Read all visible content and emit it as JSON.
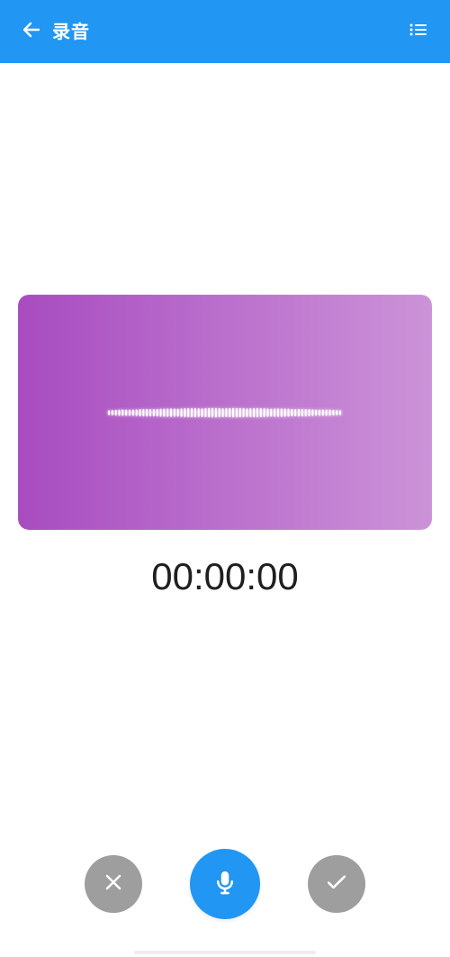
{
  "app_bar": {
    "title": "录音",
    "background_color": "#2196F3",
    "back_icon": "arrow-left-icon",
    "list_icon": "list-icon"
  },
  "wave_card": {
    "gradient_start": "#A84CC0",
    "gradient_end": "#CC93D8",
    "waveform_color": "#FFFFFF"
  },
  "timer": {
    "text": "00:00:00",
    "color": "#1F1F1F"
  },
  "controls": {
    "cancel": {
      "icon": "close-icon",
      "color": "#9E9E9E"
    },
    "record": {
      "icon": "microphone-icon",
      "color": "#2196F3"
    },
    "confirm": {
      "icon": "check-icon",
      "color": "#9E9E9E"
    }
  }
}
